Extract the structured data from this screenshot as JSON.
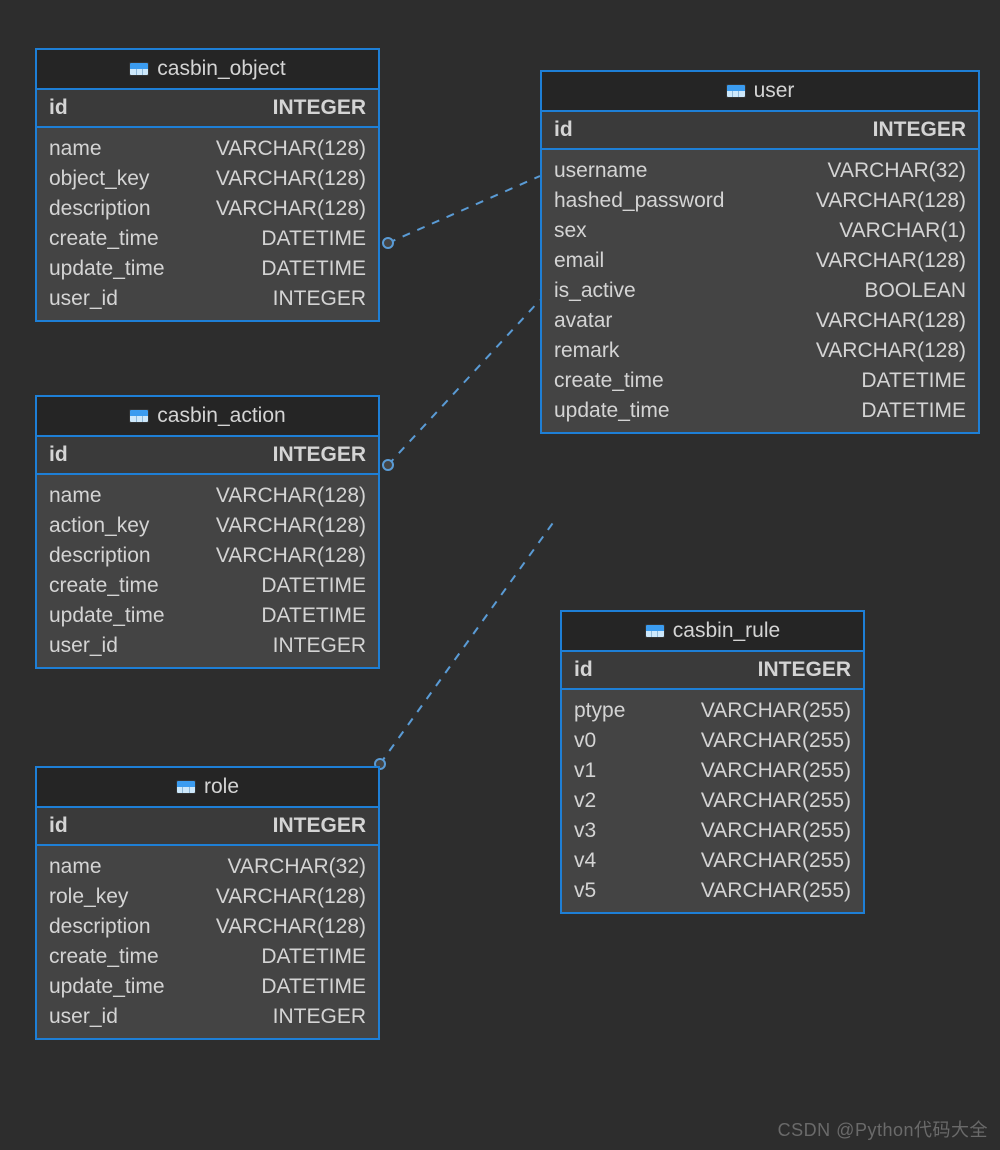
{
  "watermark": "CSDN @Python代码大全",
  "tables": {
    "casbin_object": {
      "title": "casbin_object",
      "pk": {
        "name": "id",
        "type": "INTEGER"
      },
      "cols": [
        {
          "name": "name",
          "type": "VARCHAR(128)"
        },
        {
          "name": "object_key",
          "type": "VARCHAR(128)"
        },
        {
          "name": "description",
          "type": "VARCHAR(128)"
        },
        {
          "name": "create_time",
          "type": "DATETIME"
        },
        {
          "name": "update_time",
          "type": "DATETIME"
        },
        {
          "name": "user_id",
          "type": "INTEGER"
        }
      ]
    },
    "casbin_action": {
      "title": "casbin_action",
      "pk": {
        "name": "id",
        "type": "INTEGER"
      },
      "cols": [
        {
          "name": "name",
          "type": "VARCHAR(128)"
        },
        {
          "name": "action_key",
          "type": "VARCHAR(128)"
        },
        {
          "name": "description",
          "type": "VARCHAR(128)"
        },
        {
          "name": "create_time",
          "type": "DATETIME"
        },
        {
          "name": "update_time",
          "type": "DATETIME"
        },
        {
          "name": "user_id",
          "type": "INTEGER"
        }
      ]
    },
    "role": {
      "title": "role",
      "pk": {
        "name": "id",
        "type": "INTEGER"
      },
      "cols": [
        {
          "name": "name",
          "type": "VARCHAR(32)"
        },
        {
          "name": "role_key",
          "type": "VARCHAR(128)"
        },
        {
          "name": "description",
          "type": "VARCHAR(128)"
        },
        {
          "name": "create_time",
          "type": "DATETIME"
        },
        {
          "name": "update_time",
          "type": "DATETIME"
        },
        {
          "name": "user_id",
          "type": "INTEGER"
        }
      ]
    },
    "user": {
      "title": "user",
      "pk": {
        "name": "id",
        "type": "INTEGER"
      },
      "cols": [
        {
          "name": "username",
          "type": "VARCHAR(32)"
        },
        {
          "name": "hashed_password",
          "type": "VARCHAR(128)"
        },
        {
          "name": "sex",
          "type": "VARCHAR(1)"
        },
        {
          "name": "email",
          "type": "VARCHAR(128)"
        },
        {
          "name": "is_active",
          "type": "BOOLEAN"
        },
        {
          "name": "avatar",
          "type": "VARCHAR(128)"
        },
        {
          "name": "remark",
          "type": "VARCHAR(128)"
        },
        {
          "name": "create_time",
          "type": "DATETIME"
        },
        {
          "name": "update_time",
          "type": "DATETIME"
        }
      ]
    },
    "casbin_rule": {
      "title": "casbin_rule",
      "pk": {
        "name": "id",
        "type": "INTEGER"
      },
      "cols": [
        {
          "name": "ptype",
          "type": "VARCHAR(255)"
        },
        {
          "name": "v0",
          "type": "VARCHAR(255)"
        },
        {
          "name": "v1",
          "type": "VARCHAR(255)"
        },
        {
          "name": "v2",
          "type": "VARCHAR(255)"
        },
        {
          "name": "v3",
          "type": "VARCHAR(255)"
        },
        {
          "name": "v4",
          "type": "VARCHAR(255)"
        },
        {
          "name": "v5",
          "type": "VARCHAR(255)"
        }
      ]
    }
  }
}
